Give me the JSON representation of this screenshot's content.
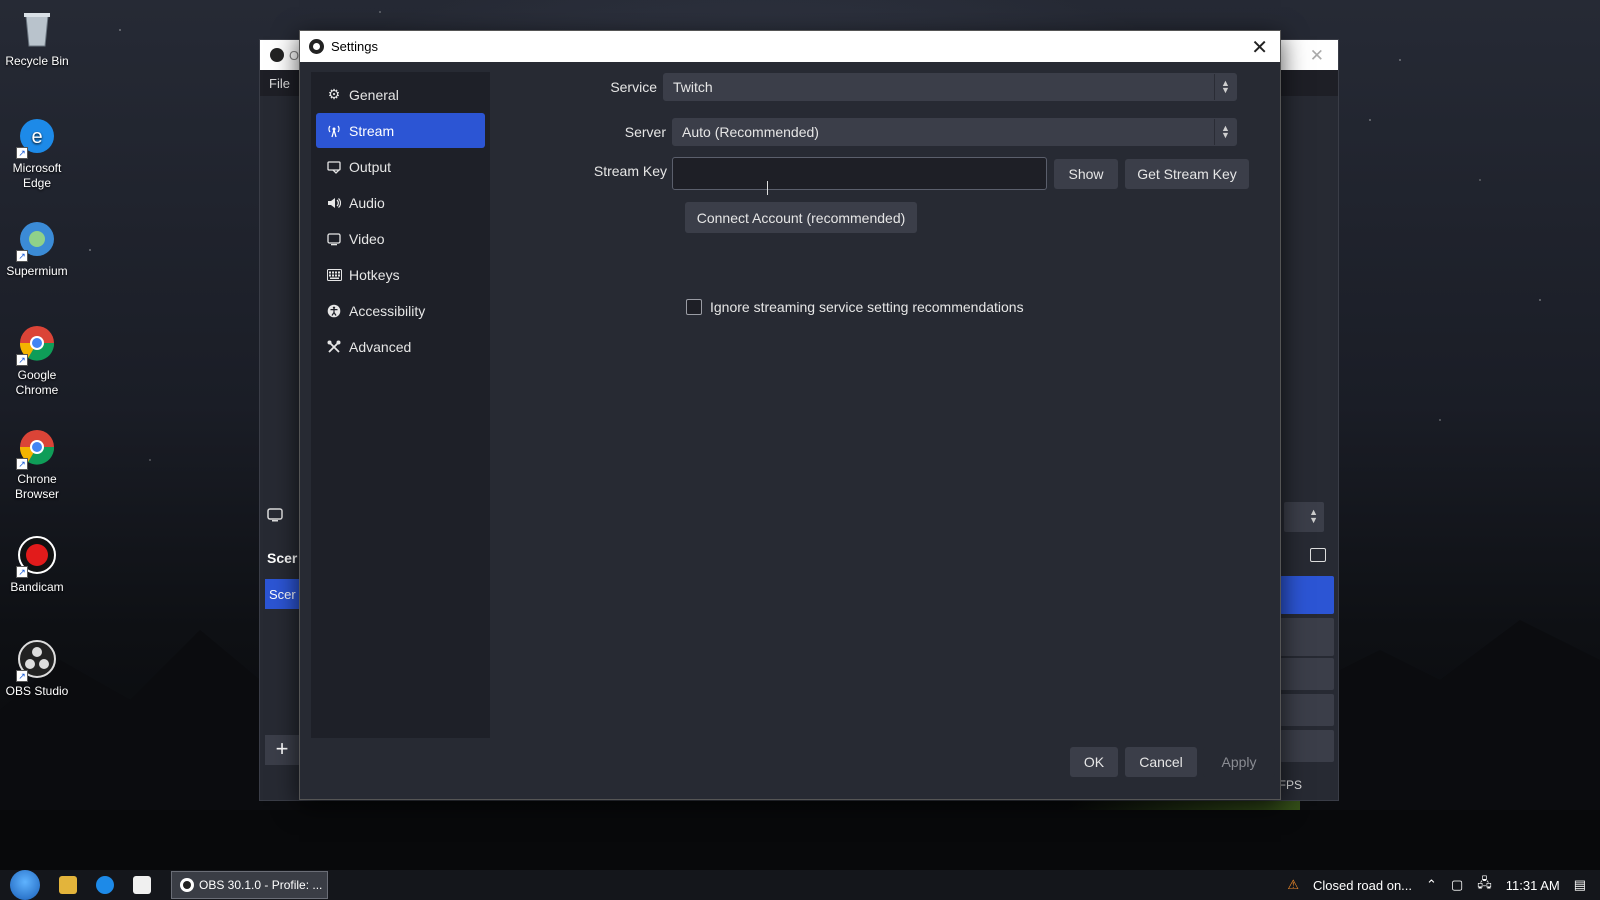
{
  "desktop": {
    "icons": [
      {
        "label": "Recycle Bin"
      },
      {
        "label": "Microsoft Edge"
      },
      {
        "label": "Supermium"
      },
      {
        "label": "Google Chrome"
      },
      {
        "label": "Chrone Browser"
      },
      {
        "label": "Bandicam"
      },
      {
        "label": "OBS Studio"
      }
    ]
  },
  "obs_main": {
    "title_fragment": "O",
    "menu_file": "File",
    "scenes_header": "Scer",
    "scene_item": "Scer",
    "add_symbol": "+",
    "fps_label": "FPS"
  },
  "dialog": {
    "title": "Settings",
    "close_symbol": "✕",
    "sidebar": [
      {
        "label": "General",
        "icon": "gear-icon",
        "glyph": "⚙"
      },
      {
        "label": "Stream",
        "icon": "antenna-icon",
        "glyph": "📡"
      },
      {
        "label": "Output",
        "icon": "output-icon",
        "glyph": "⎘"
      },
      {
        "label": "Audio",
        "icon": "speaker-icon",
        "glyph": "🔊"
      },
      {
        "label": "Video",
        "icon": "monitor-icon",
        "glyph": "▭"
      },
      {
        "label": "Hotkeys",
        "icon": "keyboard-icon",
        "glyph": "⌨"
      },
      {
        "label": "Accessibility",
        "icon": "accessibility-icon",
        "glyph": "♿"
      },
      {
        "label": "Advanced",
        "icon": "tools-icon",
        "glyph": "✂"
      }
    ],
    "active_item": "Stream",
    "stream": {
      "service_label": "Service",
      "service_value": "Twitch",
      "server_label": "Server",
      "server_value": "Auto (Recommended)",
      "stream_key_label": "Stream Key",
      "stream_key_value": "",
      "show_button": "Show",
      "get_key_button": "Get Stream Key",
      "connect_button": "Connect Account (recommended)",
      "ignore_checkbox_label": "Ignore streaming service setting recommendations",
      "ignore_checked": false
    },
    "footer": {
      "ok": "OK",
      "cancel": "Cancel",
      "apply": "Apply"
    }
  },
  "taskbar": {
    "active_task": "OBS 30.1.0 - Profile: ...",
    "notification_text": "Closed road on...",
    "time": "11:31 AM"
  },
  "colors": {
    "accent": "#2c55d4",
    "dialog_bg": "#272a33",
    "sidebar_bg": "#1e2028"
  }
}
